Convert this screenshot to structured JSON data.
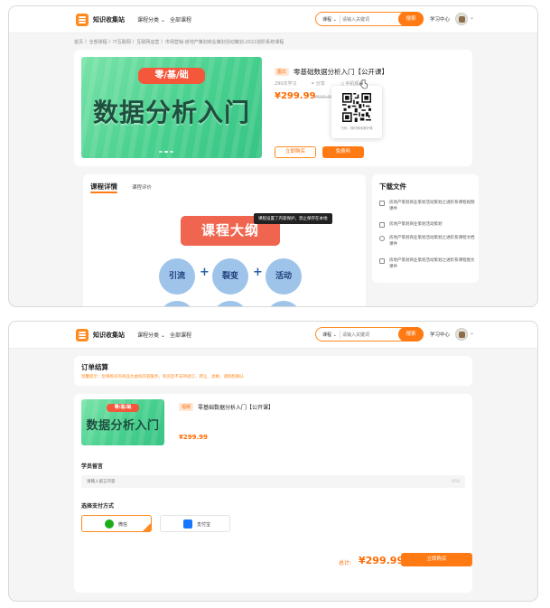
{
  "nav": {
    "site_name": "知识收集站",
    "menu_category": "课程分类 ⌄",
    "menu_all": "全部课程",
    "search_category": "课程 ⌄",
    "search_placeholder": "请输入关键词",
    "search_button": "搜索",
    "learning_center": "学习中心",
    "avatar_caret": "⌄"
  },
  "breadcrumb": "首页 〉全部课程 〉IT互联网 〉互联网运营 〉市场营销-房地产策划商业策划活动策划-2022进阶系统课程",
  "product": {
    "cover_badge": "零/基/础",
    "cover_title": "数据分析入门",
    "tag": "图文",
    "title": "零基础数据分析入门【公开课】",
    "learners": "290次学习",
    "share": "分享",
    "mobile_view": "手机观看",
    "price": "¥299.99",
    "old_price": "¥599.99",
    "buy_now": "立即购买",
    "free_trial": "免费听",
    "qr_caption": "扫码，随时随地看好课"
  },
  "detail": {
    "tab_active": "课程详情",
    "tab_other": "课程评价",
    "tooltip": "课程设置了内容保护，禁止保存在本地",
    "outline_title": "课程大纲",
    "circles": [
      "引流",
      "裂变",
      "活动"
    ],
    "plus_sign": "+"
  },
  "downloads": {
    "title": "下载文件",
    "items": [
      "房地产策划商业策划活动策划之进阶系课程视频课件",
      "房地产策划商业策划活动策划",
      "房地产策划商业策划活动策划之进阶系课程文档课件",
      "房地产策划商业策划活动策划之进阶系课程图文课件"
    ]
  },
  "order": {
    "title": "订单结算",
    "tip": "温馨提示：您将购买的商品为虚拟内容服务，购买后不支持退订、转让、退换，请斟酌确认",
    "tag": "视频",
    "product_title": "零基础数据分析入门【公开课】",
    "price": "¥299.99",
    "message_label": "学员留言",
    "message_placeholder": "请输入留言内容",
    "message_count": "0/50",
    "pay_label": "选择支付方式",
    "pay_methods": [
      "微信",
      "支付宝"
    ],
    "total_label": "总计:",
    "total_price": "¥299.99",
    "buy_button": "立即购买"
  },
  "colors": {
    "accent": "#ff7a12",
    "price": "#ff6a00",
    "cover_green": "#48d08e",
    "outline_red": "#f0654f",
    "circle_blue": "#9ec4ea",
    "wechat_green": "#1aad19",
    "alipay_blue": "#1677ff"
  }
}
